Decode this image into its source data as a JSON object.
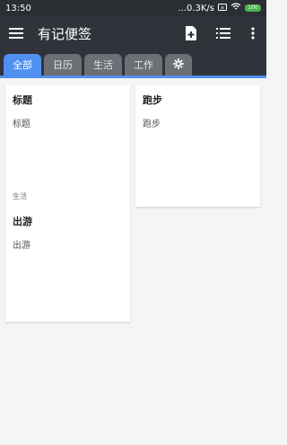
{
  "status": {
    "time": "13:50",
    "network": "...0.3K/s",
    "battery": "100"
  },
  "appbar": {
    "title": "有记便签",
    "menu_icon": "menu-icon",
    "add_icon": "add-note-icon",
    "list_icon": "list-view-icon",
    "more_icon": "more-vert-icon"
  },
  "tabs": [
    {
      "label": "全部",
      "active": true
    },
    {
      "label": "日历",
      "active": false
    },
    {
      "label": "生活",
      "active": false
    },
    {
      "label": "工作",
      "active": false
    }
  ],
  "settings_tab_icon": "gear-icon",
  "notes": [
    {
      "title": "标题",
      "body": "标题",
      "tag": "生活"
    },
    {
      "title": "跑步",
      "body": "跑步",
      "tag": ""
    },
    {
      "title": "出游",
      "body": "出游",
      "tag": ""
    }
  ],
  "colors": {
    "appbar": "#30343a",
    "accent": "#4f8ff0"
  }
}
